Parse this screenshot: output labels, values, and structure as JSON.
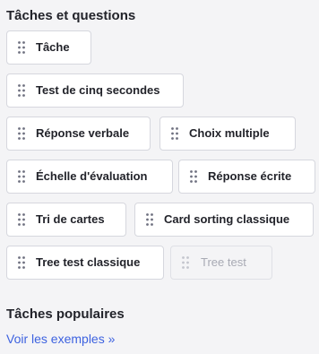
{
  "tasks_section": {
    "title": "Tâches et questions",
    "items": [
      {
        "label": "Tâche",
        "enabled": true
      },
      {
        "label": "Test de cinq secondes",
        "enabled": true
      },
      {
        "label": "Réponse verbale",
        "enabled": true
      },
      {
        "label": "Choix multiple",
        "enabled": true
      },
      {
        "label": "Échelle d'évaluation",
        "enabled": true
      },
      {
        "label": "Réponse écrite",
        "enabled": true
      },
      {
        "label": "Tri de cartes",
        "enabled": true
      },
      {
        "label": "Card sorting classique",
        "enabled": true
      },
      {
        "label": "Tree test classique",
        "enabled": true
      },
      {
        "label": "Tree test",
        "enabled": false
      }
    ]
  },
  "popular_section": {
    "title": "Tâches populaires",
    "link_label": "Voir les exemples »"
  },
  "icons": {
    "drag_handle": "drag-handle-icon"
  },
  "colors": {
    "text": "#22232a",
    "link": "#3d62e0",
    "border": "#d6d7de",
    "disabled_text": "#a8aab4",
    "background": "#f4f4f6"
  }
}
